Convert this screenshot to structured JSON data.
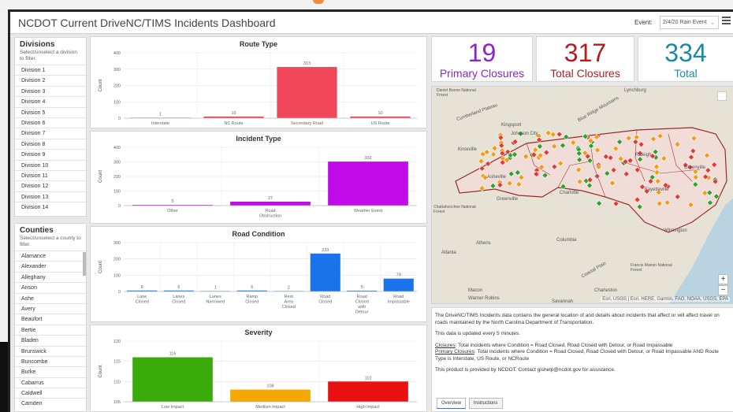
{
  "header": {
    "title": "NCDOT Current DriveNC/TIMS Incidents Dashboard",
    "event_label": "Event:",
    "event_value": "2/4/20 Rain Event"
  },
  "divisions": {
    "title": "Divisions",
    "subtitle": "Select/unselect a division to filter.",
    "items": [
      "Division 1",
      "Division 2",
      "Division 3",
      "Division 4",
      "Division 5",
      "Division 6",
      "Division 7",
      "Division 8",
      "Division 9",
      "Division 10",
      "Division 11",
      "Division 12",
      "Division 13",
      "Division 14"
    ]
  },
  "counties": {
    "title": "Counties",
    "subtitle": "Select/unselect a county to filter.",
    "items": [
      "Alamance",
      "Alexander",
      "Alleghany",
      "Anson",
      "Ashe",
      "Avery",
      "Beaufort",
      "Bertie",
      "Bladen",
      "Brunswick",
      "Buncombe",
      "Burke",
      "Cabarrus",
      "Caldwell",
      "Camden"
    ]
  },
  "kpis": {
    "primary": {
      "value": "19",
      "label": "Primary Closures",
      "color": "#8e24c9"
    },
    "total_closures": {
      "value": "317",
      "label": "Total Closures",
      "color": "#b71c1c"
    },
    "total": {
      "value": "334",
      "label": "Total",
      "color": "#1a8aa5"
    }
  },
  "chart_data": [
    {
      "type": "bar",
      "title": "Route Type",
      "ylabel": "Count",
      "ylim": [
        0,
        400
      ],
      "yticks": [
        0,
        100,
        200,
        300,
        400
      ],
      "categories": [
        "Interstate",
        "NC Route",
        "Secondary Road",
        "US Route"
      ],
      "values": [
        1,
        10,
        313,
        10
      ],
      "value_labels": [
        "1",
        "10",
        "313",
        "10"
      ],
      "color": "#f0485a"
    },
    {
      "type": "bar",
      "title": "Incident Type",
      "ylabel": "Count",
      "ylim": [
        0,
        400
      ],
      "yticks": [
        0,
        100,
        200,
        300,
        400
      ],
      "categories": [
        "Other",
        "Road Obstruction",
        "Weather Event"
      ],
      "values": [
        5,
        27,
        302
      ],
      "value_labels": [
        "5",
        "27",
        "302"
      ],
      "color": "#c10ae8"
    },
    {
      "type": "bar",
      "title": "Road Condition",
      "ylabel": "Count",
      "ylim": [
        0,
        300
      ],
      "yticks": [
        0,
        100,
        200,
        300
      ],
      "categories": [
        "Lane Closed",
        "Lanes Closed",
        "Lanes Narrowed",
        "Ramp Closed",
        "Rest Area Closed",
        "Road Closed",
        "Road Closed with Detour",
        "Road Impassable"
      ],
      "values": [
        6,
        6,
        1,
        6,
        2,
        233,
        5,
        79
      ],
      "value_labels": [
        "6",
        "6",
        "1",
        "6",
        "2",
        "233",
        "5",
        "79"
      ],
      "color": "#1a73e8"
    },
    {
      "type": "bar",
      "title": "Severity",
      "ylabel": "Count",
      "ylim": [
        105,
        120
      ],
      "yticks": [
        105,
        110,
        115,
        120
      ],
      "categories": [
        "Low Impact",
        "Medium Impact",
        "High Impact"
      ],
      "values": [
        116,
        108,
        110
      ],
      "value_labels": [
        "116",
        "108",
        "110"
      ],
      "colors": [
        "#3aab0a",
        "#f4a800",
        "#e81010"
      ]
    }
  ],
  "map": {
    "attribution": "Esri, USGS | Esri, HERE, Garmin, FAO, NOAA, USGS, EPA",
    "labels": [
      "Lynchburg",
      "Kingsport",
      "Johnson City",
      "Knoxville",
      "Asheville",
      "Greenville",
      "Charlotte",
      "Fayetteville",
      "Greenville",
      "Wilmington",
      "Columbia",
      "Athens",
      "Atlanta",
      "Macon",
      "Warner Robins",
      "Charleston",
      "Savannah",
      "Raleigh",
      "Blue Ridge Mountains",
      "Cumberland Plateau",
      "Coastal Plain",
      "Daniel Boone National Forest",
      "Chattahoochee National Forest",
      "Francis Marion National Forest"
    ],
    "zoom_in": "+",
    "zoom_out": "−"
  },
  "info": {
    "p1": "The DriveNC/TIMS Incidents data contains the general location of and details about incidents that affect or will affect travel on roads maintained by the North Carolina Department of Transportation.",
    "p2": "This data is updated every 5 minutes.",
    "closures_term": "Closures",
    "closures_def": ": Total incidents where Condition = Road Closed, Road Closed with Detour, or Road Impassable",
    "primary_term": "Primary Closures",
    "primary_def": ": Total incidents where Condition = Road Closed, Road Closed with Detour, or Road Impassable AND Route Type is Interstate, US Route, or NCRoute",
    "p4": "This product is provided by NCDOT.  Contact gishelp@ncdot.gov for assistance.",
    "tabs": [
      "Overview",
      "Instructions"
    ]
  },
  "colors": {
    "accent": "#2b7bd6",
    "map_point_red": "#e53935",
    "map_point_orange": "#f39c12",
    "map_point_green": "#2ea12e"
  }
}
